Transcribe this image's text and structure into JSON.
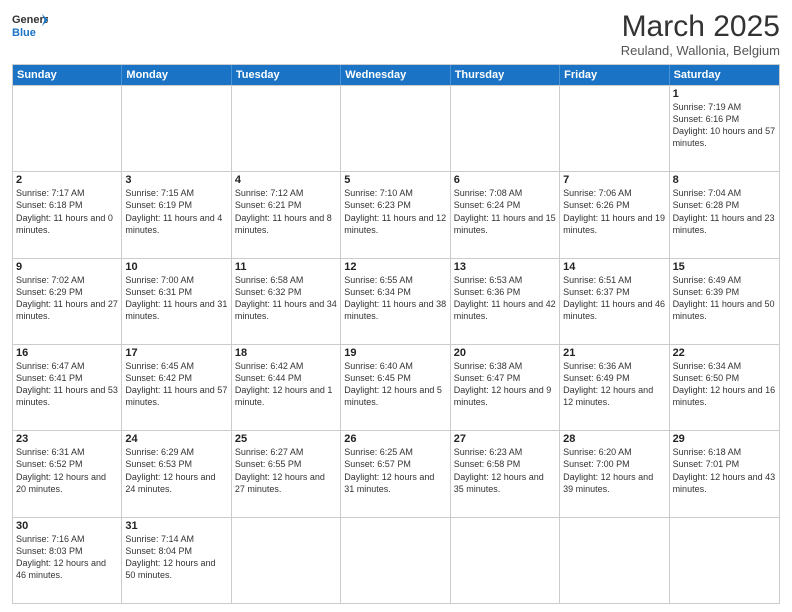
{
  "header": {
    "logo_general": "General",
    "logo_blue": "Blue",
    "month_title": "March 2025",
    "subtitle": "Reuland, Wallonia, Belgium"
  },
  "days_of_week": [
    "Sunday",
    "Monday",
    "Tuesday",
    "Wednesday",
    "Thursday",
    "Friday",
    "Saturday"
  ],
  "weeks": [
    [
      {
        "day": "",
        "info": ""
      },
      {
        "day": "",
        "info": ""
      },
      {
        "day": "",
        "info": ""
      },
      {
        "day": "",
        "info": ""
      },
      {
        "day": "",
        "info": ""
      },
      {
        "day": "",
        "info": ""
      },
      {
        "day": "1",
        "info": "Sunrise: 7:19 AM\nSunset: 6:16 PM\nDaylight: 10 hours and 57 minutes."
      }
    ],
    [
      {
        "day": "2",
        "info": "Sunrise: 7:17 AM\nSunset: 6:18 PM\nDaylight: 11 hours and 0 minutes."
      },
      {
        "day": "3",
        "info": "Sunrise: 7:15 AM\nSunset: 6:19 PM\nDaylight: 11 hours and 4 minutes."
      },
      {
        "day": "4",
        "info": "Sunrise: 7:12 AM\nSunset: 6:21 PM\nDaylight: 11 hours and 8 minutes."
      },
      {
        "day": "5",
        "info": "Sunrise: 7:10 AM\nSunset: 6:23 PM\nDaylight: 11 hours and 12 minutes."
      },
      {
        "day": "6",
        "info": "Sunrise: 7:08 AM\nSunset: 6:24 PM\nDaylight: 11 hours and 15 minutes."
      },
      {
        "day": "7",
        "info": "Sunrise: 7:06 AM\nSunset: 6:26 PM\nDaylight: 11 hours and 19 minutes."
      },
      {
        "day": "8",
        "info": "Sunrise: 7:04 AM\nSunset: 6:28 PM\nDaylight: 11 hours and 23 minutes."
      }
    ],
    [
      {
        "day": "9",
        "info": "Sunrise: 7:02 AM\nSunset: 6:29 PM\nDaylight: 11 hours and 27 minutes."
      },
      {
        "day": "10",
        "info": "Sunrise: 7:00 AM\nSunset: 6:31 PM\nDaylight: 11 hours and 31 minutes."
      },
      {
        "day": "11",
        "info": "Sunrise: 6:58 AM\nSunset: 6:32 PM\nDaylight: 11 hours and 34 minutes."
      },
      {
        "day": "12",
        "info": "Sunrise: 6:55 AM\nSunset: 6:34 PM\nDaylight: 11 hours and 38 minutes."
      },
      {
        "day": "13",
        "info": "Sunrise: 6:53 AM\nSunset: 6:36 PM\nDaylight: 11 hours and 42 minutes."
      },
      {
        "day": "14",
        "info": "Sunrise: 6:51 AM\nSunset: 6:37 PM\nDaylight: 11 hours and 46 minutes."
      },
      {
        "day": "15",
        "info": "Sunrise: 6:49 AM\nSunset: 6:39 PM\nDaylight: 11 hours and 50 minutes."
      }
    ],
    [
      {
        "day": "16",
        "info": "Sunrise: 6:47 AM\nSunset: 6:41 PM\nDaylight: 11 hours and 53 minutes."
      },
      {
        "day": "17",
        "info": "Sunrise: 6:45 AM\nSunset: 6:42 PM\nDaylight: 11 hours and 57 minutes."
      },
      {
        "day": "18",
        "info": "Sunrise: 6:42 AM\nSunset: 6:44 PM\nDaylight: 12 hours and 1 minute."
      },
      {
        "day": "19",
        "info": "Sunrise: 6:40 AM\nSunset: 6:45 PM\nDaylight: 12 hours and 5 minutes."
      },
      {
        "day": "20",
        "info": "Sunrise: 6:38 AM\nSunset: 6:47 PM\nDaylight: 12 hours and 9 minutes."
      },
      {
        "day": "21",
        "info": "Sunrise: 6:36 AM\nSunset: 6:49 PM\nDaylight: 12 hours and 12 minutes."
      },
      {
        "day": "22",
        "info": "Sunrise: 6:34 AM\nSunset: 6:50 PM\nDaylight: 12 hours and 16 minutes."
      }
    ],
    [
      {
        "day": "23",
        "info": "Sunrise: 6:31 AM\nSunset: 6:52 PM\nDaylight: 12 hours and 20 minutes."
      },
      {
        "day": "24",
        "info": "Sunrise: 6:29 AM\nSunset: 6:53 PM\nDaylight: 12 hours and 24 minutes."
      },
      {
        "day": "25",
        "info": "Sunrise: 6:27 AM\nSunset: 6:55 PM\nDaylight: 12 hours and 27 minutes."
      },
      {
        "day": "26",
        "info": "Sunrise: 6:25 AM\nSunset: 6:57 PM\nDaylight: 12 hours and 31 minutes."
      },
      {
        "day": "27",
        "info": "Sunrise: 6:23 AM\nSunset: 6:58 PM\nDaylight: 12 hours and 35 minutes."
      },
      {
        "day": "28",
        "info": "Sunrise: 6:20 AM\nSunset: 7:00 PM\nDaylight: 12 hours and 39 minutes."
      },
      {
        "day": "29",
        "info": "Sunrise: 6:18 AM\nSunset: 7:01 PM\nDaylight: 12 hours and 43 minutes."
      }
    ],
    [
      {
        "day": "30",
        "info": "Sunrise: 7:16 AM\nSunset: 8:03 PM\nDaylight: 12 hours and 46 minutes."
      },
      {
        "day": "31",
        "info": "Sunrise: 7:14 AM\nSunset: 8:04 PM\nDaylight: 12 hours and 50 minutes."
      },
      {
        "day": "",
        "info": ""
      },
      {
        "day": "",
        "info": ""
      },
      {
        "day": "",
        "info": ""
      },
      {
        "day": "",
        "info": ""
      },
      {
        "day": "",
        "info": ""
      }
    ]
  ]
}
